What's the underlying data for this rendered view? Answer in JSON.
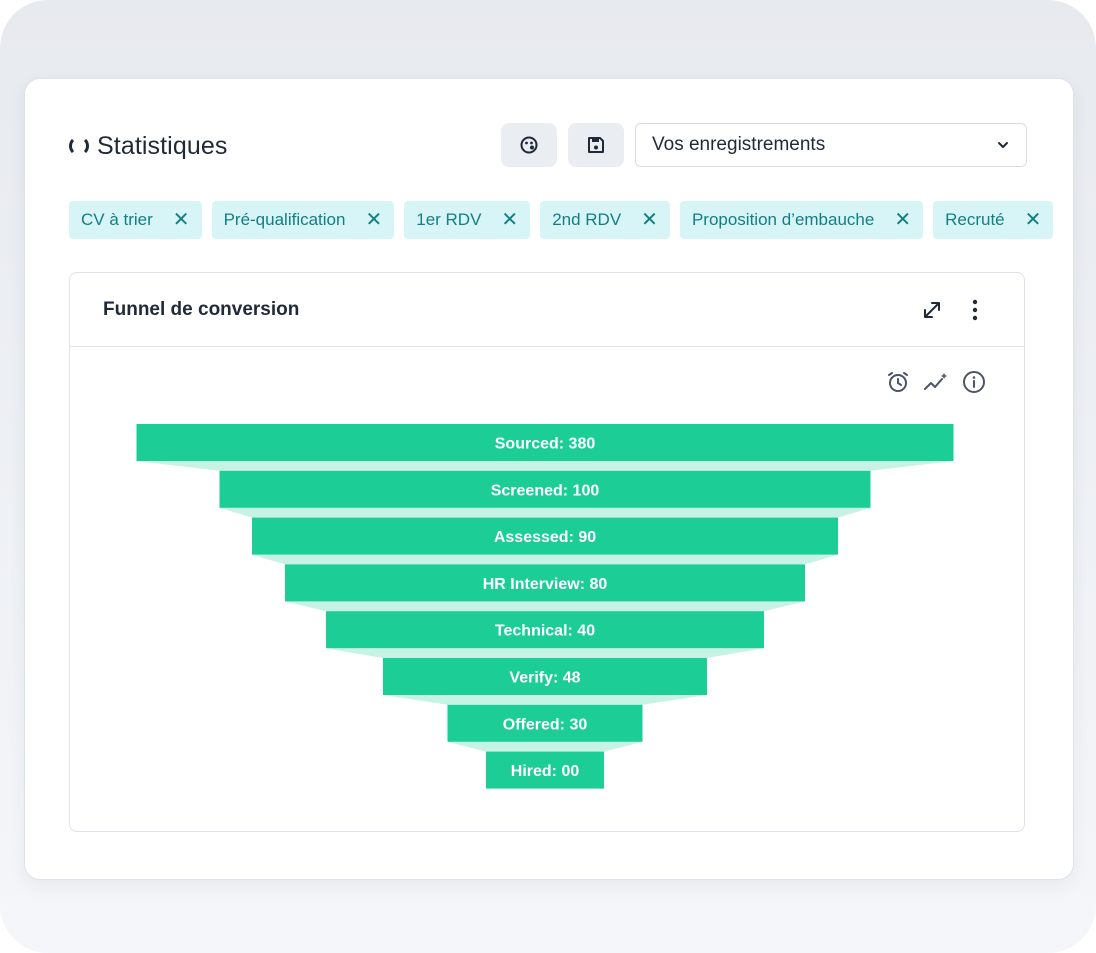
{
  "header": {
    "title": "Statistiques",
    "dropdown_value": "Vos enregistrements",
    "palette_icon": "palette-icon",
    "save_icon": "floppy-disk-icon",
    "chevron_icon": "chevron-down-icon"
  },
  "filters": [
    {
      "label": "CV à trier"
    },
    {
      "label": "Pré-qualification"
    },
    {
      "label": "1er RDV"
    },
    {
      "label": "2nd RDV"
    },
    {
      "label": "Proposition d’embauche"
    },
    {
      "label": "Recruté"
    }
  ],
  "panel": {
    "title": "Funnel de conversion",
    "icons": [
      "expand-icon",
      "kebab-menu-icon",
      "alarm-clock-icon",
      "sparkline-icon",
      "info-icon"
    ]
  },
  "chart_data": {
    "type": "funnel",
    "categories": [
      "Sourced",
      "Screened",
      "Assessed",
      "HR Interview",
      "Technical",
      "Verify",
      "Offered",
      "Hired"
    ],
    "labels": [
      "Sourced: 380",
      "Screened: 100",
      "Assessed: 90",
      "HR Interview: 80",
      "Technical: 40",
      "Verify: 48",
      "Offered: 30",
      "Hired: 00"
    ],
    "values": [
      380,
      100,
      90,
      80,
      40,
      48,
      30,
      0
    ],
    "colors": {
      "bar": "#1ccd96",
      "connector": "#c6f3e3",
      "label": "#ffffff"
    }
  },
  "colors": {
    "tag_bg": "#d7f5f6",
    "tag_text": "#137e85"
  }
}
